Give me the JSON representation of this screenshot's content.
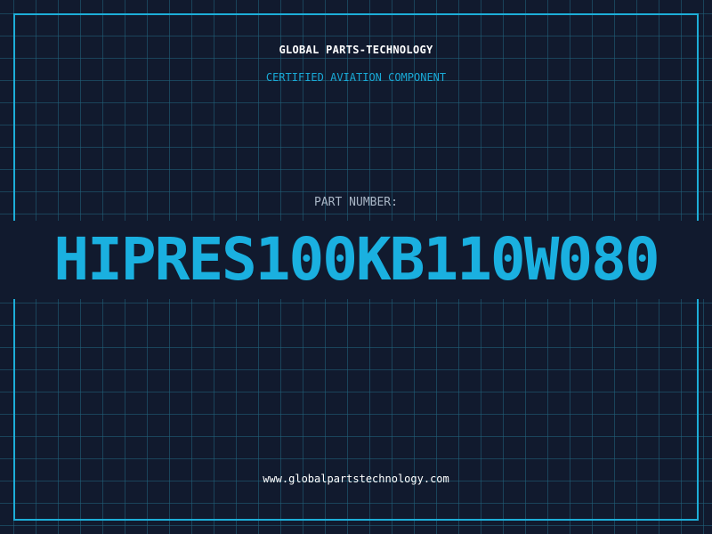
{
  "header": {
    "company": "GLOBAL PARTS-TECHNOLOGY",
    "tagline": "CERTIFIED AVIATION COMPONENT"
  },
  "part": {
    "label": "PART NUMBER:",
    "number": "HIPRES100KB110W080"
  },
  "footer": {
    "website": "www.globalpartstechnology.com"
  },
  "colors": {
    "background": "#111a2e",
    "grid": "#20647d",
    "accent": "#1ab0e0",
    "label": "#a9b6c6",
    "text": "#ffffff"
  }
}
